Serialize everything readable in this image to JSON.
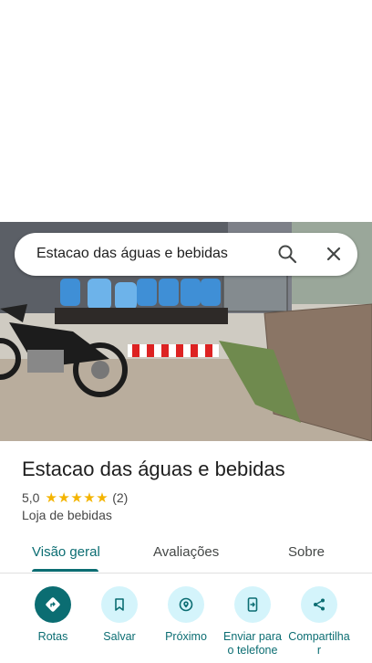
{
  "search": {
    "query": "Estacao das águas e bebidas"
  },
  "place": {
    "name": "Estacao das águas e bebidas",
    "rating": "5,0",
    "stars": "★★★★★",
    "review_count": "(2)",
    "category": "Loja de bebidas"
  },
  "tabs": [
    {
      "label": "Visão geral",
      "active": true
    },
    {
      "label": "Avaliações",
      "active": false
    },
    {
      "label": "Sobre",
      "active": false
    }
  ],
  "actions": [
    {
      "label": "Rotas",
      "icon": "directions-icon"
    },
    {
      "label": "Salvar",
      "icon": "bookmark-icon"
    },
    {
      "label": "Próximo",
      "icon": "nearby-icon"
    },
    {
      "label": "Enviar para o telefone",
      "icon": "send-to-phone-icon"
    },
    {
      "label": "Compartilhar",
      "icon": "share-icon"
    }
  ],
  "colors": {
    "accent": "#0b6d72",
    "action_bg": "#d4f4fb",
    "star": "#f4b400"
  }
}
